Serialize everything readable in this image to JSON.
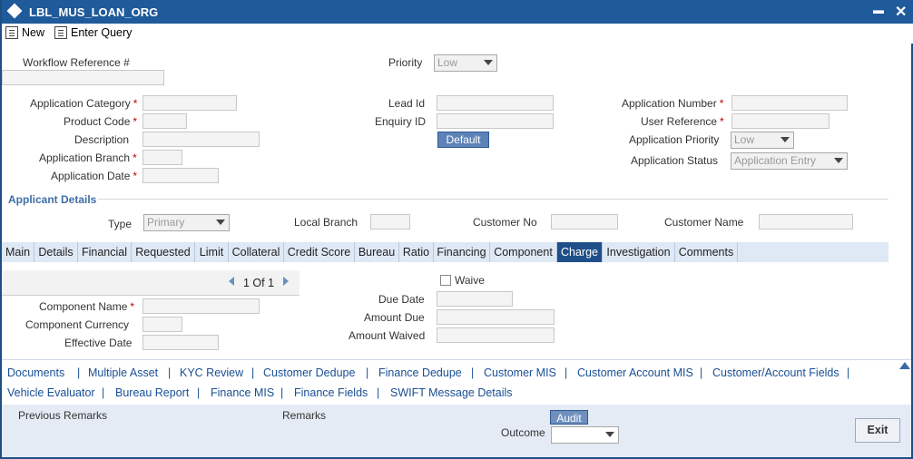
{
  "window": {
    "title": "LBL_MUS_LOAN_ORG",
    "minimize": "▬",
    "close": "✕"
  },
  "toolbar": {
    "new_label": "New",
    "enter_query_label": "Enter Query"
  },
  "form": {
    "workflow_ref_label": "Workflow Reference #",
    "priority_label": "Priority",
    "priority_value": "Low",
    "app_category_label": "Application Category",
    "product_code_label": "Product Code",
    "description_label": "Description",
    "app_branch_label": "Application Branch",
    "app_date_label": "Application Date",
    "lead_id_label": "Lead Id",
    "enquiry_id_label": "Enquiry ID",
    "default_button": "Default",
    "app_number_label": "Application Number",
    "user_ref_label": "User Reference",
    "app_priority_label": "Application Priority",
    "app_priority_value": "Low",
    "app_status_label": "Application Status",
    "app_status_value": "Application Entry",
    "required_mark": "*"
  },
  "applicant": {
    "section_title": "Applicant Details",
    "type_label": "Type",
    "type_value": "Primary",
    "local_branch_label": "Local Branch",
    "customer_no_label": "Customer No",
    "customer_name_label": "Customer Name"
  },
  "tabs": [
    {
      "label": "Main"
    },
    {
      "label": "Details"
    },
    {
      "label": "Financial"
    },
    {
      "label": "Requested"
    },
    {
      "label": "Limit"
    },
    {
      "label": "Collateral"
    },
    {
      "label": "Credit Score"
    },
    {
      "label": "Bureau"
    },
    {
      "label": "Ratio"
    },
    {
      "label": "Financing"
    },
    {
      "label": "Component"
    },
    {
      "label": "Charge"
    },
    {
      "label": "Investigation"
    },
    {
      "label": "Comments"
    }
  ],
  "charge": {
    "pager_text": "1 Of 1",
    "waive_label": "Waive",
    "component_name_label": "Component Name",
    "component_currency_label": "Component Currency",
    "effective_date_label": "Effective Date",
    "due_date_label": "Due Date",
    "amount_due_label": "Amount Due",
    "amount_waived_label": "Amount Waived"
  },
  "links_row1": [
    "Documents",
    "Multiple Asset",
    "KYC Review",
    "Customer Dedupe",
    "Finance Dedupe",
    "Customer MIS",
    "Customer Account MIS",
    "Customer/Account Fields"
  ],
  "links_row2": [
    "Vehicle Evaluator",
    "Bureau Report",
    "Finance MIS",
    "Finance Fields",
    "SWIFT Message Details"
  ],
  "link_separator": "|",
  "footer": {
    "previous_remarks_label": "Previous Remarks",
    "remarks_label": "Remarks",
    "audit_button": "Audit",
    "outcome_label": "Outcome",
    "exit_button": "Exit"
  },
  "colors": {
    "title_bar": "#1f5a9a",
    "active_tab": "#1f4f88",
    "link": "#1a4f94",
    "required": "#c00000"
  }
}
